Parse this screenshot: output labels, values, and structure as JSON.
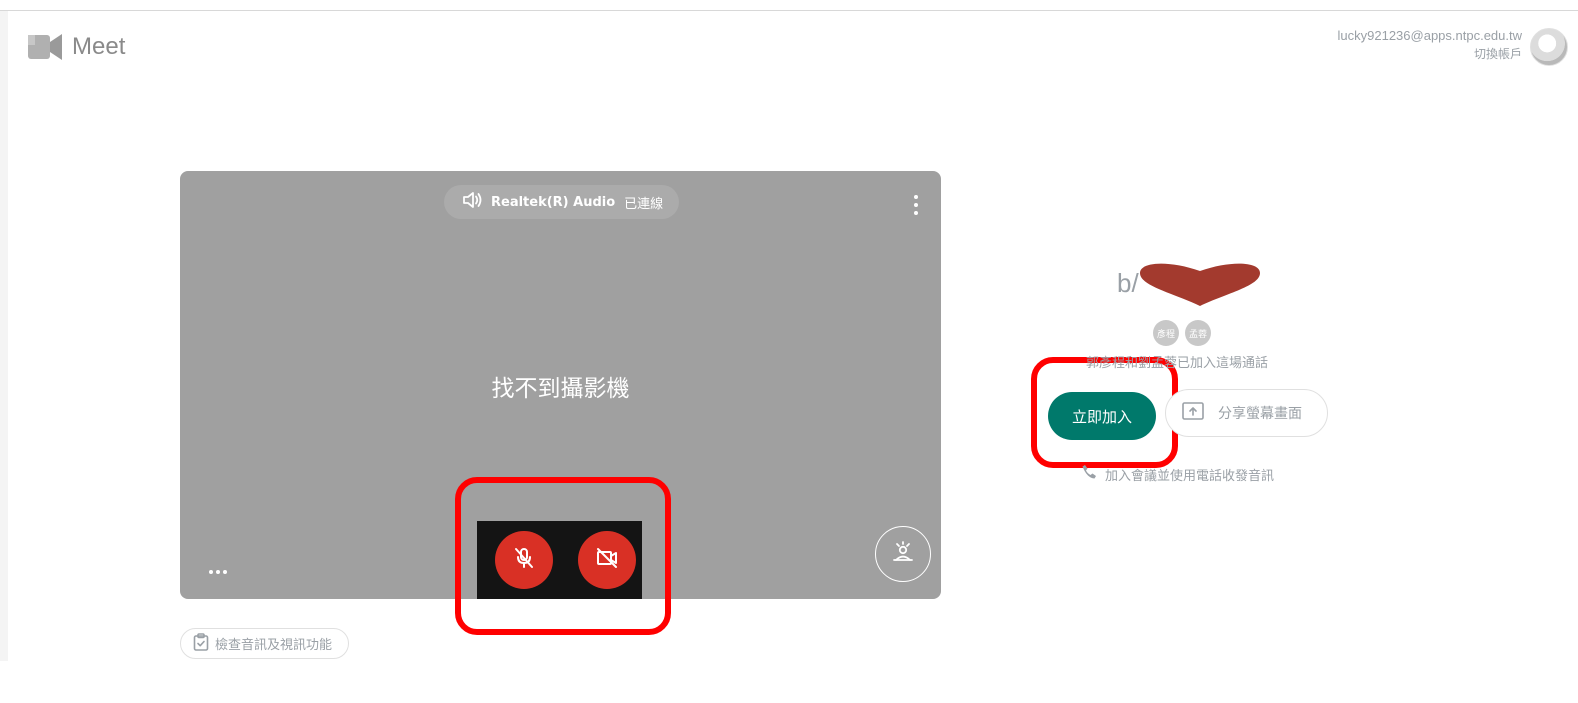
{
  "header": {
    "app_name": "Meet",
    "account_email": "lucky921236@apps.ntpc.edu.tw",
    "switch_account": "切換帳戶"
  },
  "preview": {
    "audio_device": "Realtek(R) Audio",
    "audio_status": "已連線",
    "no_camera_text": "找不到攝影機",
    "mic_state": "muted",
    "camera_state": "off"
  },
  "check_button": "檢查音訊及視訊功能",
  "meeting": {
    "title_visible": "b/",
    "participants": [
      "彥程",
      "孟蓉"
    ],
    "joined_text": "郭彥程和劉孟蓉已加入這場通話",
    "join_button": "立即加入",
    "share_button": "分享螢幕畫面",
    "phone_link": "加入會議並使用電話收發音訊"
  },
  "colors": {
    "join_button": "#00796b",
    "control_red": "#d93025",
    "annotation_red": "#ff0000",
    "preview_bg": "#a0a0a0"
  }
}
